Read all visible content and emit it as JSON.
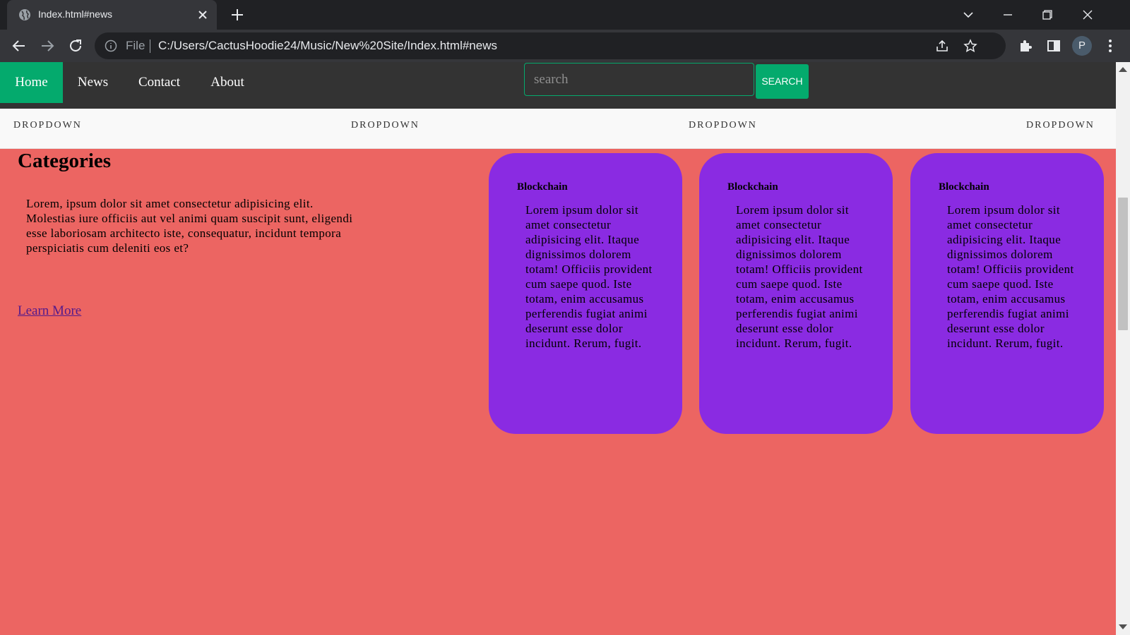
{
  "browser": {
    "tab_title": "Index.html#news",
    "omnibox_scheme": "File",
    "url": "C:/Users/CactusHoodie24/Music/New%20Site/Index.html#news",
    "profile_initial": "P"
  },
  "site": {
    "nav": [
      {
        "label": "Home",
        "active": true
      },
      {
        "label": "News",
        "active": false
      },
      {
        "label": "Contact",
        "active": false
      },
      {
        "label": "About",
        "active": false
      }
    ],
    "search": {
      "placeholder": "search",
      "button_label": "SEARCH"
    },
    "dropdowns": [
      "DROPDOWN",
      "DROPDOWN",
      "DROPDOWN",
      "DROPDOWN"
    ],
    "categories": {
      "title": "Categories",
      "text": "Lorem, ipsum dolor sit amet consectetur adipisicing elit. Molestias iure officiis aut vel animi quam suscipit sunt, eligendi esse laboriosam architecto iste, consequatur, incidunt tempora perspiciatis cum deleniti eos et?",
      "link": "Learn More"
    },
    "cards": [
      {
        "title": "Blockchain",
        "text": "Lorem ipsum dolor sit amet consectetur adipisicing elit. Itaque dignissimos dolorem totam! Officiis provident cum saepe quod. Iste totam, enim accusamus perferendis fugiat animi deserunt esse dolor incidunt. Rerum, fugit."
      },
      {
        "title": "Blockchain",
        "text": "Lorem ipsum dolor sit amet consectetur adipisicing elit. Itaque dignissimos dolorem totam! Officiis provident cum saepe quod. Iste totam, enim accusamus perferendis fugiat animi deserunt esse dolor incidunt. Rerum, fugit."
      },
      {
        "title": "Blockchain",
        "text": "Lorem ipsum dolor sit amet consectetur adipisicing elit. Itaque dignissimos dolorem totam! Officiis provident cum saepe quod. Iste totam, enim accusamus perferendis fugiat animi deserunt esse dolor incidunt. Rerum, fugit."
      }
    ]
  },
  "colors": {
    "page_background": "#ec6562",
    "nav_background": "#333333",
    "accent_green": "#04aa6d",
    "card_purple": "#8a2be2",
    "link_color": "#551a8b"
  }
}
